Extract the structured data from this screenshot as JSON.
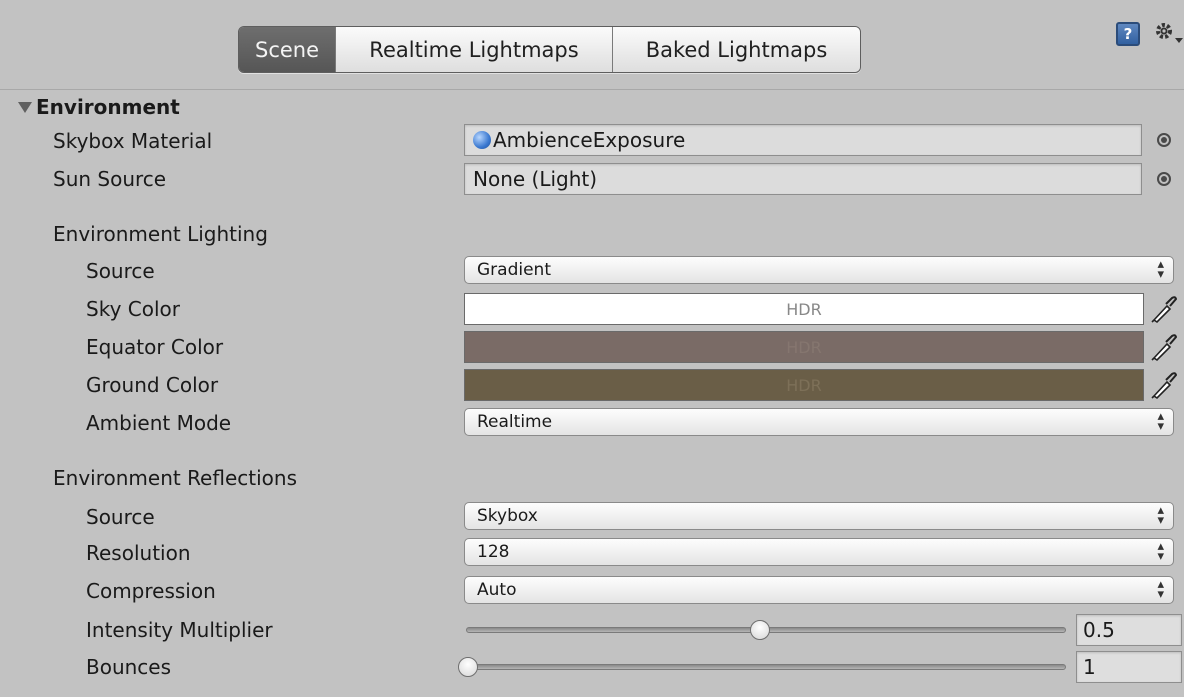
{
  "tabs": [
    {
      "label": "Scene",
      "active": true
    },
    {
      "label": "Realtime Lightmaps",
      "active": false
    },
    {
      "label": "Baked Lightmaps",
      "active": false
    }
  ],
  "toolbar_icons": [
    "help-book-icon",
    "gear-icon"
  ],
  "environment": {
    "header": "Environment",
    "skybox_material": {
      "label": "Skybox Material",
      "value": "AmbienceExposure"
    },
    "sun_source": {
      "label": "Sun Source",
      "value": "None (Light)"
    }
  },
  "environment_lighting": {
    "header": "Environment Lighting",
    "source": {
      "label": "Source",
      "value": "Gradient"
    },
    "sky_color": {
      "label": "Sky Color",
      "text": "HDR",
      "color": "#ffffff"
    },
    "equator_color": {
      "label": "Equator Color",
      "text": "HDR",
      "color": "#7a6b66"
    },
    "ground_color": {
      "label": "Ground Color",
      "text": "HDR",
      "color": "#6a5e47"
    },
    "ambient_mode": {
      "label": "Ambient Mode",
      "value": "Realtime"
    }
  },
  "environment_reflections": {
    "header": "Environment Reflections",
    "source": {
      "label": "Source",
      "value": "Skybox"
    },
    "resolution": {
      "label": "Resolution",
      "value": "128"
    },
    "compression": {
      "label": "Compression",
      "value": "Auto"
    },
    "intensity_multiplier": {
      "label": "Intensity Multiplier",
      "value": "0.5",
      "fraction": 0.5
    },
    "bounces": {
      "label": "Bounces",
      "value": "1",
      "fraction": 0.0
    }
  }
}
